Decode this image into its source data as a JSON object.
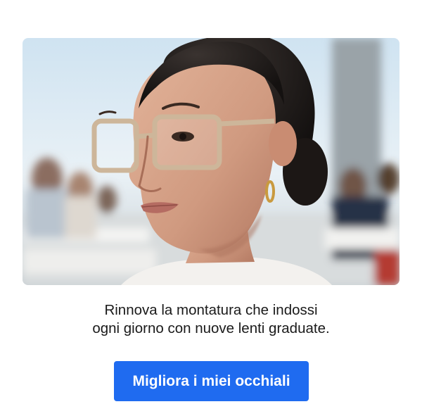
{
  "promo": {
    "image_alt": "Woman wearing clear beige frame eyeglasses at an outdoor terrace",
    "caption_line_1": "Rinnova la montatura che indossi",
    "caption_line_2": "ogni giorno con nuove lenti graduate.",
    "cta_label": "Migliora i miei occhiali"
  },
  "colors": {
    "cta_background": "#1f6bf0",
    "cta_text": "#ffffff",
    "caption_text": "#1a1a1a"
  }
}
